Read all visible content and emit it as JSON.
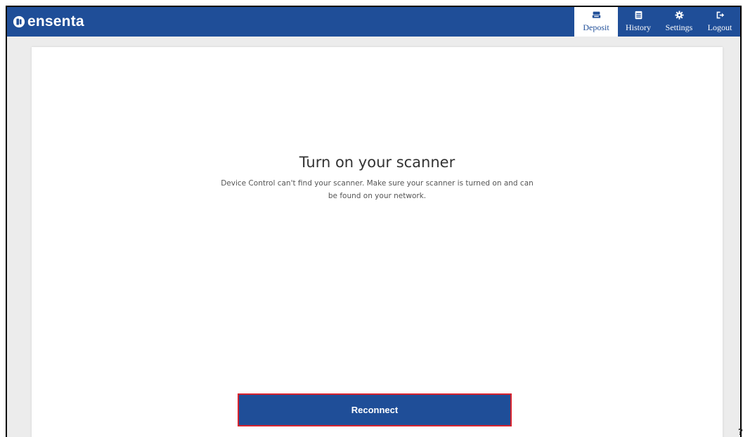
{
  "brand": {
    "name": "ensenta"
  },
  "nav": [
    {
      "label": "Deposit",
      "icon": "scanner-icon",
      "active": true
    },
    {
      "label": "History",
      "icon": "document-list-icon",
      "active": false
    },
    {
      "label": "Settings",
      "icon": "gear-icon",
      "active": false
    },
    {
      "label": "Logout",
      "icon": "logout-icon",
      "active": false
    }
  ],
  "main": {
    "title": "Turn on your scanner",
    "message": "Device Control can't find your scanner. Make sure your scanner is turned on and can be found on your network.",
    "button_label": "Reconnect"
  },
  "colors": {
    "header": "#1f4e98",
    "button": "#1f4e98",
    "button_border": "#d9232e"
  },
  "help": {
    "glyph": "?"
  }
}
